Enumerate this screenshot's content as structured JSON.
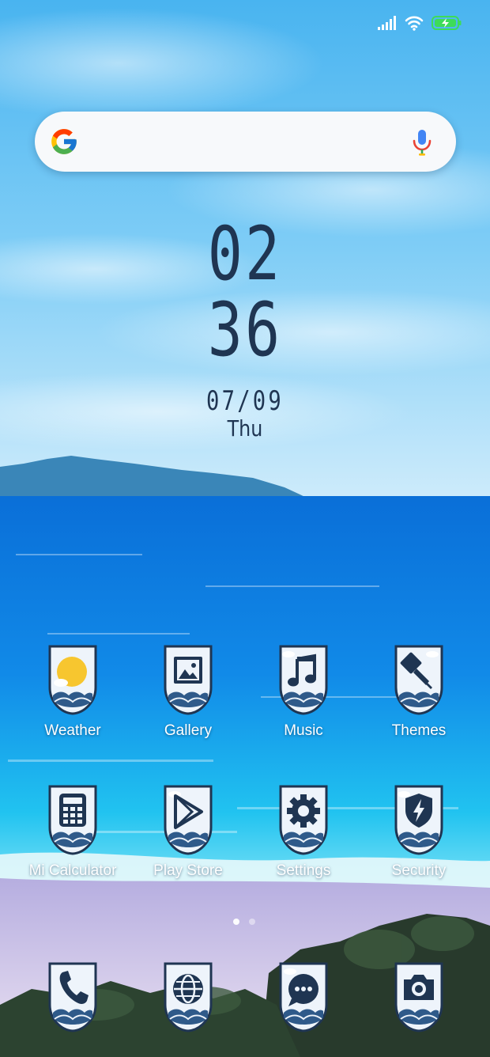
{
  "status_bar": {
    "signal_icon": "signal-bars-icon",
    "wifi_icon": "wifi-icon",
    "battery_icon": "battery-charging-icon",
    "battery_color": "#3ddc59"
  },
  "search_bar": {
    "logo_icon": "google-g-icon",
    "mic_icon": "microphone-icon"
  },
  "clock": {
    "hours": "02",
    "minutes": "36",
    "date": "07/09",
    "day": "Thu",
    "color": "#1f3552"
  },
  "apps_row1": [
    {
      "label": "Weather",
      "icon": "weather-sun-icon"
    },
    {
      "label": "Gallery",
      "icon": "gallery-image-icon"
    },
    {
      "label": "Music",
      "icon": "music-note-icon"
    },
    {
      "label": "Themes",
      "icon": "paint-brush-icon"
    }
  ],
  "apps_row2": [
    {
      "label": "Mi Calculator",
      "icon": "calculator-icon"
    },
    {
      "label": "Play Store",
      "icon": "play-store-icon"
    },
    {
      "label": "Settings",
      "icon": "gear-icon"
    },
    {
      "label": "Security",
      "icon": "shield-bolt-icon"
    }
  ],
  "page_indicator": {
    "pages": 2,
    "current": 1
  },
  "dock": [
    {
      "icon": "phone-icon"
    },
    {
      "icon": "browser-globe-icon"
    },
    {
      "icon": "messages-icon"
    },
    {
      "icon": "camera-icon"
    }
  ],
  "icon_theme": {
    "frame": "#1f3552",
    "fill": "#eef4fb",
    "wave": "#2f5a8a"
  }
}
